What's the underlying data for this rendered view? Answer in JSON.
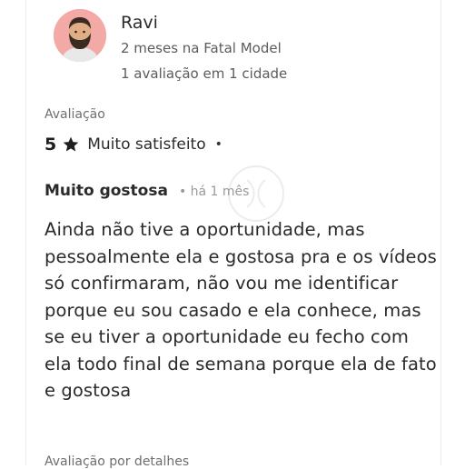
{
  "reviewer": {
    "name": "Ravi",
    "tenure": "2 meses na Fatal Model",
    "reviews_summary": "1 avaliação em 1 cidade"
  },
  "rating": {
    "section_label": "Avaliação",
    "score": "5",
    "text": "Muito satisfeito",
    "separator": "•"
  },
  "review": {
    "title": "Muito gostosa",
    "time": "• há 1 mês",
    "body": "Ainda não tive a oportunidade, mas pessoalmente ela e gostosa pra e os vídeos só confirmaram, não vou me identificar porque eu sou casado e ela conhece, mas se eu tiver a oportunidade eu fecho com ela todo final de semana porque ela de fato e gostosa"
  },
  "footer": {
    "label": "Avaliação por detalhes"
  },
  "colors": {
    "avatar_bg": "#f3a9a6",
    "text": "#2a2a2a",
    "muted": "#6e6e6e"
  },
  "icons": {
    "avatar": "bearded-man-avatar",
    "rating": "star-icon",
    "watermark": "brand-watermark-icon"
  }
}
